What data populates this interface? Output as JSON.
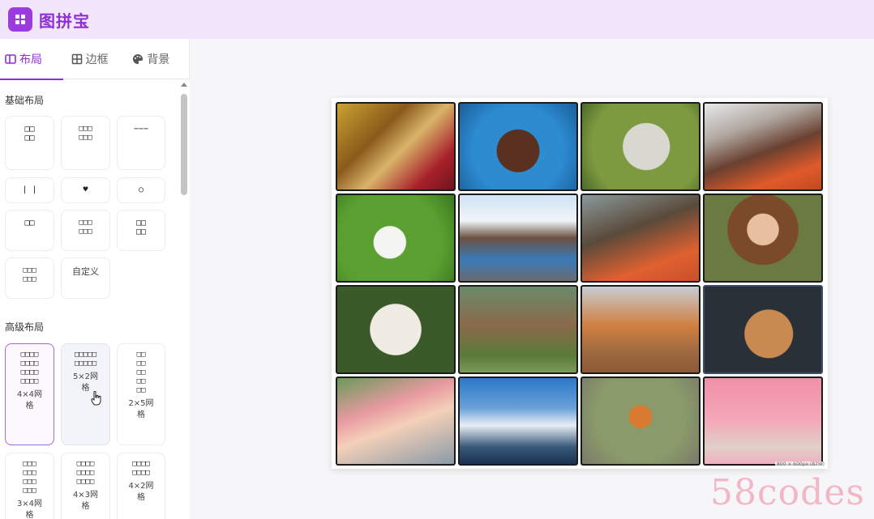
{
  "app": {
    "title": "图拼宝"
  },
  "tabs": [
    {
      "label": "布局",
      "active": true
    },
    {
      "label": "边框",
      "active": false
    },
    {
      "label": "背景",
      "active": false
    }
  ],
  "sections": {
    "basic_title": "基础布局",
    "advanced_title": "高级布局"
  },
  "basic_layouts": [
    {
      "glyph": "□□\n□□"
    },
    {
      "glyph": "□□□\n□□□"
    },
    {
      "glyph": "−−−"
    },
    {
      "glyph": "| |"
    },
    {
      "glyph": "♥"
    },
    {
      "glyph": "○"
    },
    {
      "glyph": "□□"
    },
    {
      "glyph": "□□□\n□□□"
    },
    {
      "glyph": "□□\n□□"
    },
    {
      "glyph": "□□□\n□□□"
    },
    {
      "label": "自定义"
    }
  ],
  "advanced_layouts": [
    {
      "glyph": "□□□□\n□□□□\n□□□□\n□□□□",
      "label": "4×4网格",
      "selected": true
    },
    {
      "glyph": "□□□□□\n□□□□□",
      "label": "5×2网格",
      "hover": true
    },
    {
      "glyph": "□□\n□□\n□□\n□□\n□□",
      "label": "2×5网格"
    },
    {
      "glyph": "□□□\n□□□\n□□□\n□□□",
      "label": "3×4网格"
    },
    {
      "glyph": "□□□□\n□□□□\n□□□□",
      "label": "4×3网格"
    },
    {
      "glyph": "□□□□\n□□□□",
      "label": "4×2网格"
    }
  ],
  "canvas": {
    "size_label": "800 × 600px (87%)",
    "photos": [
      "woman-autumn",
      "dog-blue",
      "cat-grass",
      "woman-curly",
      "kitten-grass",
      "woman-hat",
      "woman-curly-2",
      "woman-glasses",
      "dog-fluffy",
      "cat-meadow",
      "puppy-box",
      "cat-dark",
      "woman-flowers",
      "mountain",
      "robin",
      "dogs-pink"
    ]
  },
  "watermark": "58codes",
  "colors": {
    "accent": "#8f2fd3",
    "header_bg": "#f1e6fc"
  }
}
